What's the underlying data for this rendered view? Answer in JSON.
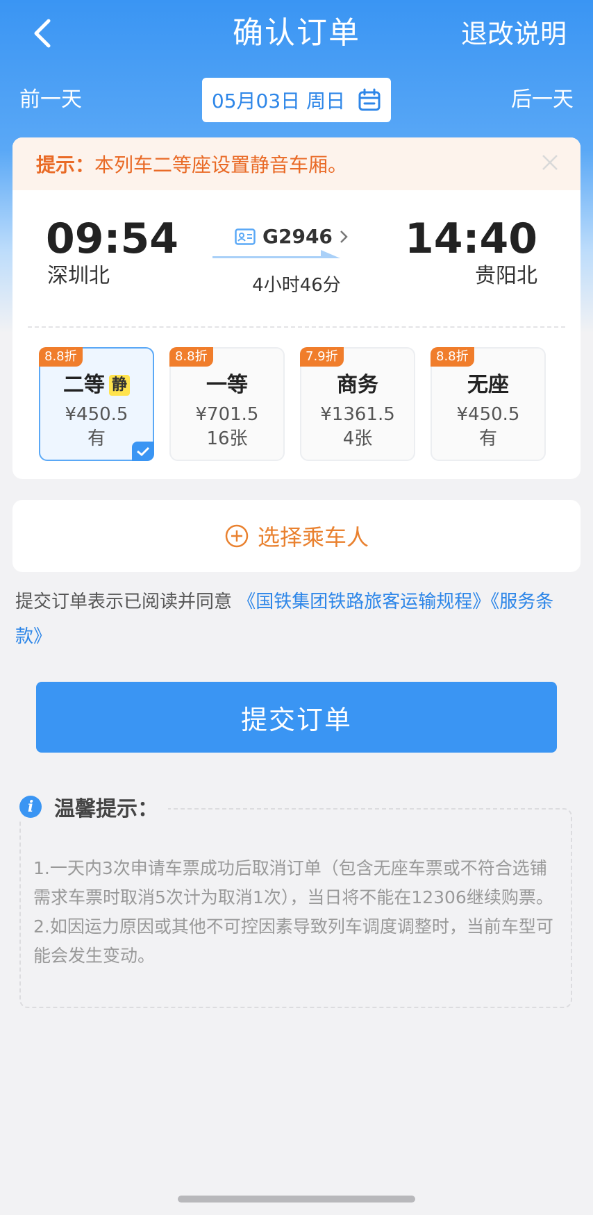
{
  "header": {
    "title": "确认订单",
    "right_action": "退改说明"
  },
  "date_nav": {
    "prev": "前一天",
    "date": "05月03日 周日",
    "next": "后一天"
  },
  "tip": {
    "label": "提示：",
    "text": "本列车二等座设置静音车厢。"
  },
  "train": {
    "depart_time": "09:54",
    "depart_station": "深圳北",
    "arrive_time": "14:40",
    "arrive_station": "贵阳北",
    "number": "G2946",
    "duration": "4小时46分"
  },
  "seats": [
    {
      "discount": "8.8折",
      "name": "二等",
      "tag": "静",
      "price": "¥450.5",
      "availability": "有",
      "selected": true
    },
    {
      "discount": "8.8折",
      "name": "一等",
      "price": "¥701.5",
      "availability": "16张"
    },
    {
      "discount": "7.9折",
      "name": "商务",
      "price": "¥1361.5",
      "availability": "4张"
    },
    {
      "discount": "8.8折",
      "name": "无座",
      "price": "¥450.5",
      "availability": "有"
    }
  ],
  "passenger": {
    "label": "选择乘车人"
  },
  "agreement": {
    "prefix": "提交订单表示已阅读并同意 ",
    "link1": "《国铁集团铁路旅客运输规程》",
    "link2": "《服务条款》"
  },
  "submit_label": "提交订单",
  "notice": {
    "title": "温馨提示：",
    "items": [
      "1.一天内3次申请车票成功后取消订单（包含无座车票或不符合选铺需求车票时取消5次计为取消1次），当日将不能在12306继续购票。",
      "2.如因运力原因或其他不可控因素导致列车调度调整时，当前车型可能会发生变动。"
    ]
  },
  "colors": {
    "primary": "#3a95f3",
    "accent_orange": "#e96a26",
    "tip_bg": "#fdf3ec",
    "page_bg": "#f2f2f4"
  }
}
